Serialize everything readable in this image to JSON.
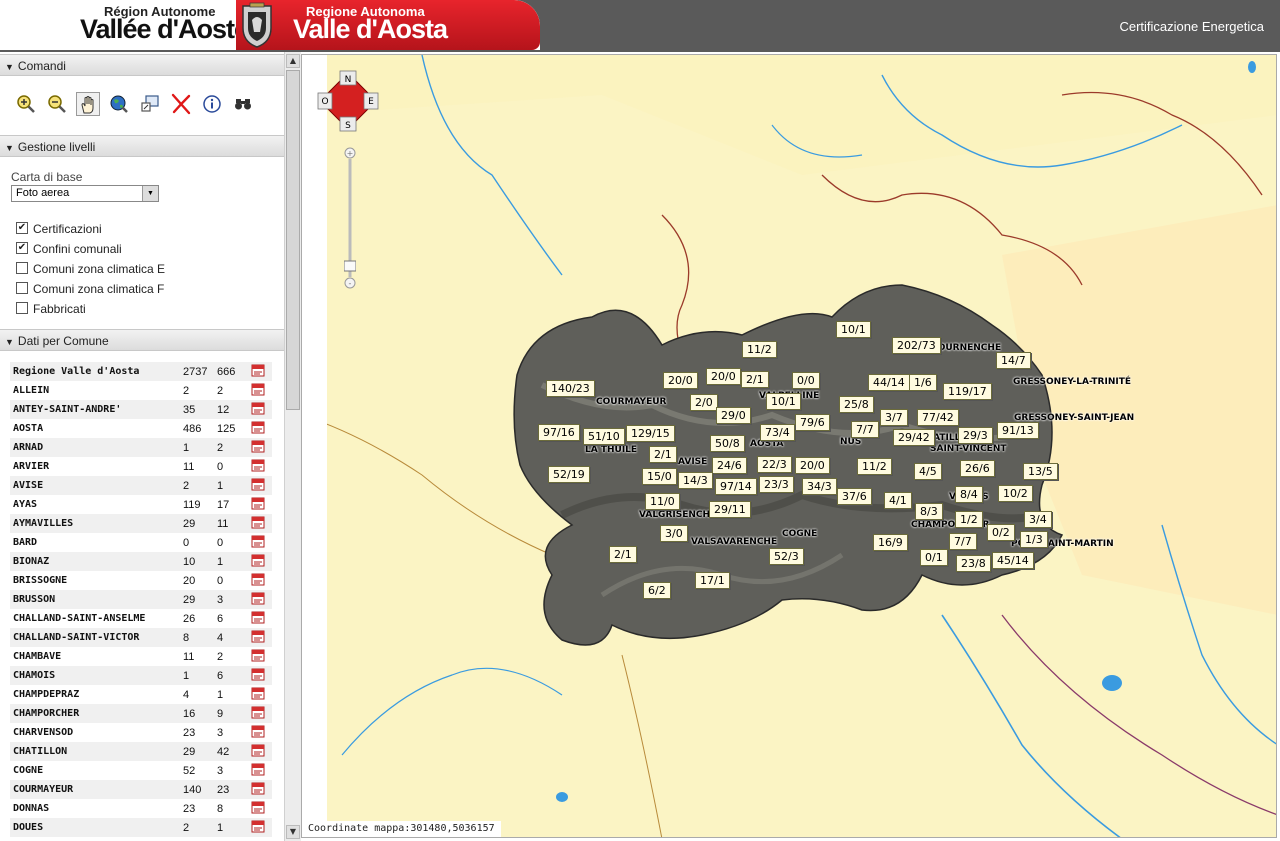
{
  "header": {
    "brand_fr_small": "Région Autonome",
    "brand_fr_big": "Vallée d'Aoste",
    "brand_it_small": "Regione Autonoma",
    "brand_it_big": "Valle d'Aosta",
    "app_title": "Certificazione Energetica"
  },
  "sidebar": {
    "sections": {
      "comandi": "Comandi",
      "livelli": "Gestione livelli",
      "dati": "Dati per Comune"
    },
    "tools": [
      {
        "name": "zoom-in-icon"
      },
      {
        "name": "zoom-out-icon"
      },
      {
        "name": "pan-hand-icon",
        "active": true
      },
      {
        "name": "globe-extent-icon"
      },
      {
        "name": "zoom-box-icon"
      },
      {
        "name": "clear-x-icon"
      },
      {
        "name": "info-icon"
      },
      {
        "name": "binoculars-icon"
      }
    ],
    "base_map_label": "Carta di base",
    "base_map_value": "Foto aerea",
    "layers": [
      {
        "label": "Certificazioni",
        "checked": true
      },
      {
        "label": "Confini comunali",
        "checked": true
      },
      {
        "label": "Comuni zona climatica E",
        "checked": false
      },
      {
        "label": "Comuni zona climatica F",
        "checked": false
      },
      {
        "label": "Fabbricati",
        "checked": false
      }
    ],
    "comuni": [
      {
        "name": "Regione Valle d'Aosta",
        "a": "2737",
        "b": "666"
      },
      {
        "name": "ALLEIN",
        "a": "2",
        "b": "2"
      },
      {
        "name": "ANTEY-SAINT-ANDRE'",
        "a": "35",
        "b": "12"
      },
      {
        "name": "AOSTA",
        "a": "486",
        "b": "125"
      },
      {
        "name": "ARNAD",
        "a": "1",
        "b": "2"
      },
      {
        "name": "ARVIER",
        "a": "11",
        "b": "0"
      },
      {
        "name": "AVISE",
        "a": "2",
        "b": "1"
      },
      {
        "name": "AYAS",
        "a": "119",
        "b": "17"
      },
      {
        "name": "AYMAVILLES",
        "a": "29",
        "b": "11"
      },
      {
        "name": "BARD",
        "a": "0",
        "b": "0"
      },
      {
        "name": "BIONAZ",
        "a": "10",
        "b": "1"
      },
      {
        "name": "BRISSOGNE",
        "a": "20",
        "b": "0"
      },
      {
        "name": "BRUSSON",
        "a": "29",
        "b": "3"
      },
      {
        "name": "CHALLAND-SAINT-ANSELME",
        "a": "26",
        "b": "6"
      },
      {
        "name": "CHALLAND-SAINT-VICTOR",
        "a": "8",
        "b": "4"
      },
      {
        "name": "CHAMBAVE",
        "a": "11",
        "b": "2"
      },
      {
        "name": "CHAMOIS",
        "a": "1",
        "b": "6"
      },
      {
        "name": "CHAMPDEPRAZ",
        "a": "4",
        "b": "1"
      },
      {
        "name": "CHAMPORCHER",
        "a": "16",
        "b": "9"
      },
      {
        "name": "CHARVENSOD",
        "a": "23",
        "b": "3"
      },
      {
        "name": "CHATILLON",
        "a": "29",
        "b": "42"
      },
      {
        "name": "COGNE",
        "a": "52",
        "b": "3"
      },
      {
        "name": "COURMAYEUR",
        "a": "140",
        "b": "23"
      },
      {
        "name": "DONNAS",
        "a": "23",
        "b": "8"
      },
      {
        "name": "DOUES",
        "a": "2",
        "b": "1"
      }
    ]
  },
  "map": {
    "compass": {
      "n": "N",
      "s": "S",
      "e": "E",
      "o": "O"
    },
    "coords": "Coordinate mappa:301480,5036157",
    "towns": [
      "COURMAYEUR",
      "LA THUILE",
      "AVISE",
      "VALGRISENCHE",
      "VALSAVARENCHE",
      "COGNE",
      "AOSTA",
      "NUS",
      "VALPELLINE",
      "CHATILLON",
      "SAINT-VINCENT",
      "CHAMPORCHER",
      "PONT-SAINT-MARTIN",
      "GRESSONEY-LA-TRINITÉ",
      "GRESSONEY-SAINT-JEAN",
      "VALTOURNENCHE",
      "VERRÈS"
    ],
    "labels": [
      "10/1",
      "11/2",
      "202/73",
      "14/7",
      "140/23",
      "20/0",
      "20/0",
      "2/1",
      "0/0",
      "44/14",
      "1/6",
      "119/17",
      "2/0",
      "10/1",
      "25/8",
      "29/0",
      "79/6",
      "3/7",
      "77/42",
      "97/16",
      "51/10",
      "129/15",
      "73/4",
      "7/7",
      "29/42",
      "29/3",
      "91/13",
      "50/8",
      "2/1",
      "24/6",
      "22/3",
      "20/0",
      "11/2",
      "4/5",
      "26/6",
      "13/5",
      "52/19",
      "15/0",
      "14/3",
      "97/14",
      "23/3",
      "34/3",
      "37/6",
      "4/1",
      "8/4",
      "10/2",
      "11/0",
      "29/11",
      "8/3",
      "1/2",
      "0/2",
      "3/4",
      "3/0",
      "16/9",
      "7/7",
      "1/3",
      "2/1",
      "52/3",
      "0/1",
      "23/8",
      "45/14",
      "17/1",
      "6/2"
    ]
  }
}
